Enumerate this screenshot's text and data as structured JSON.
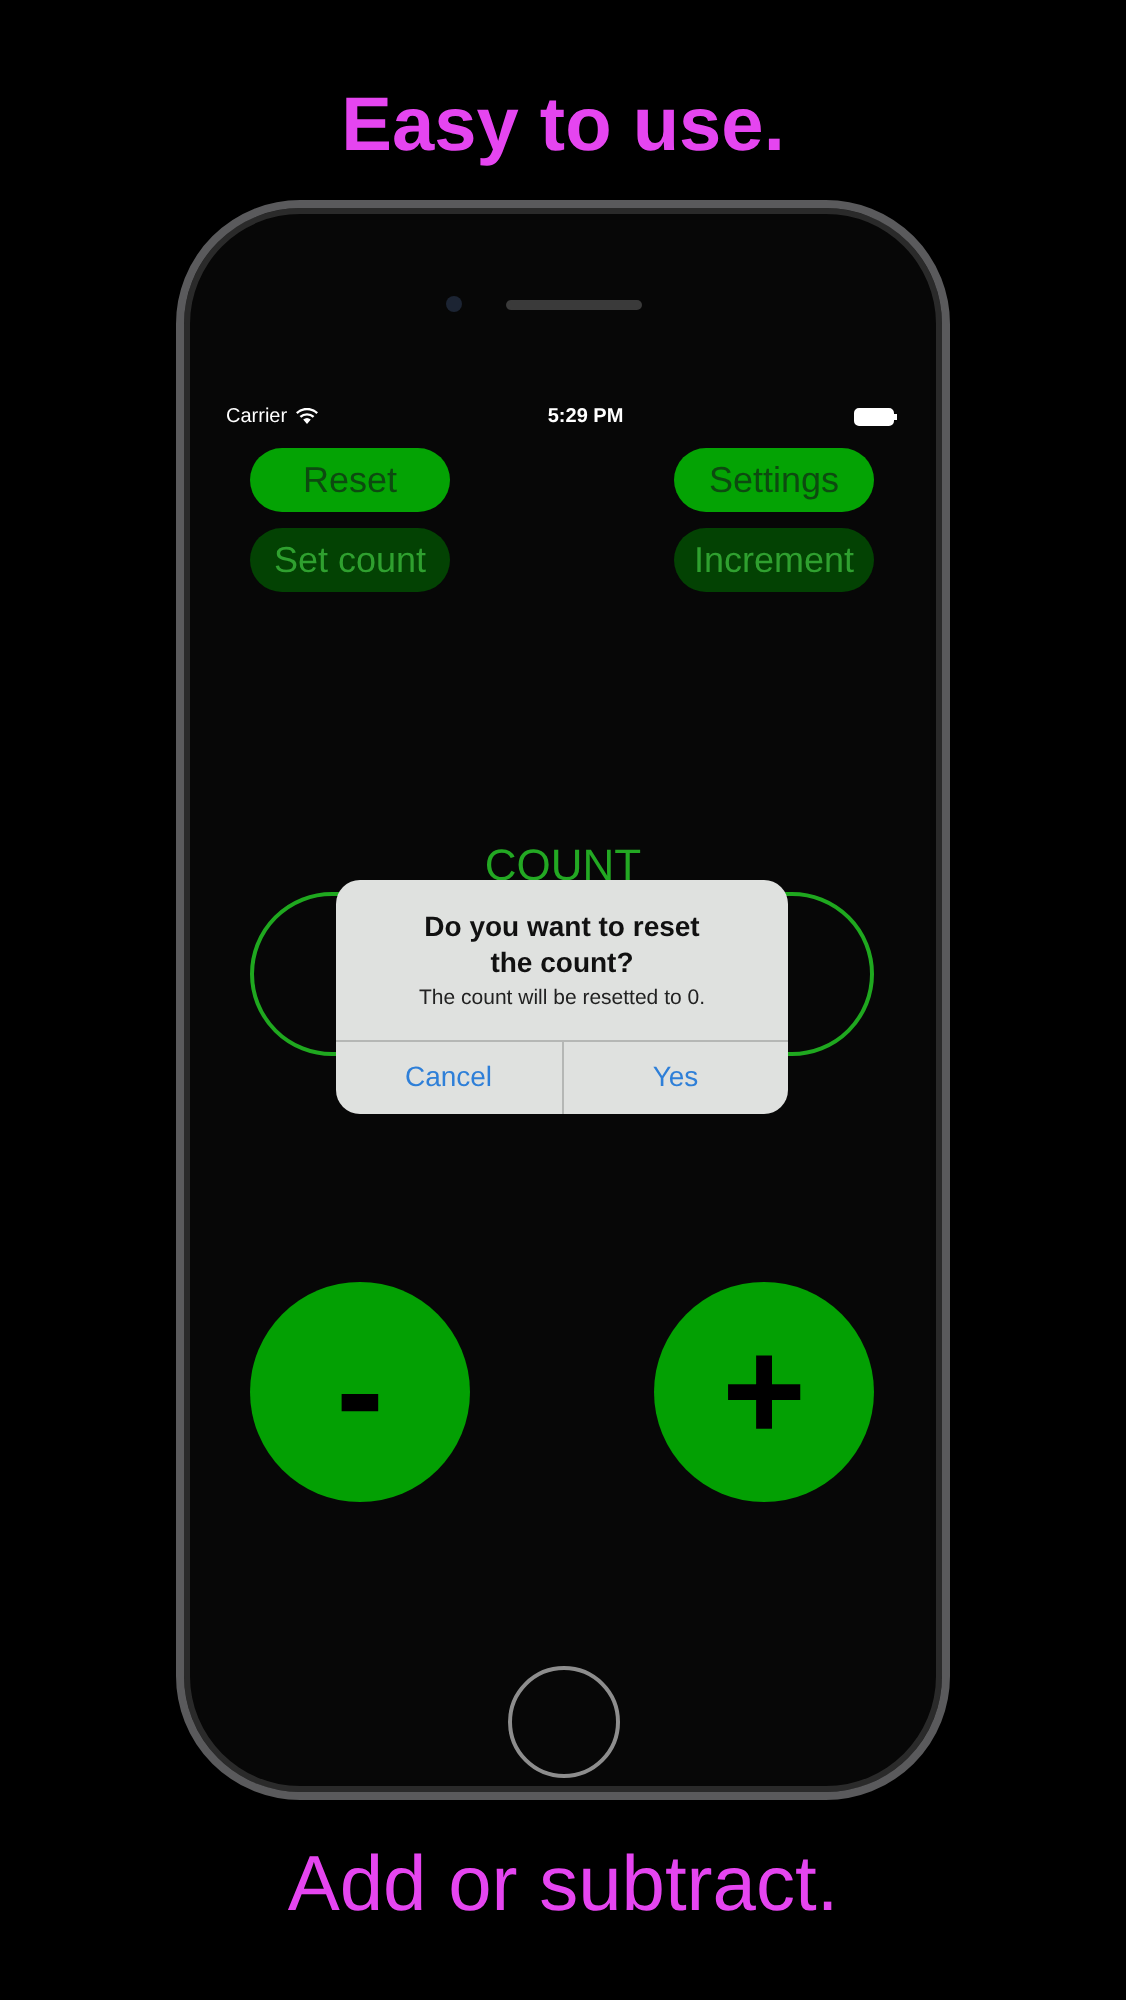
{
  "headline": "Easy to use.",
  "status_bar": {
    "carrier": "Carrier",
    "time": "5:29 PM"
  },
  "top_buttons": [
    {
      "label": "Reset",
      "enabled": true
    },
    {
      "label": "Settings",
      "enabled": true
    },
    {
      "label": "Set count",
      "enabled": false
    },
    {
      "label": "Increment",
      "enabled": false
    }
  ],
  "counter": {
    "label": "COUNT"
  },
  "alert": {
    "title": "Do you want to reset the count?",
    "message": "The count will be resetted to 0.",
    "buttons": [
      "Cancel",
      "Yes"
    ]
  },
  "step_buttons": [
    {
      "symbol": "-"
    },
    {
      "symbol": "+"
    }
  ],
  "caption": "Add or subtract."
}
